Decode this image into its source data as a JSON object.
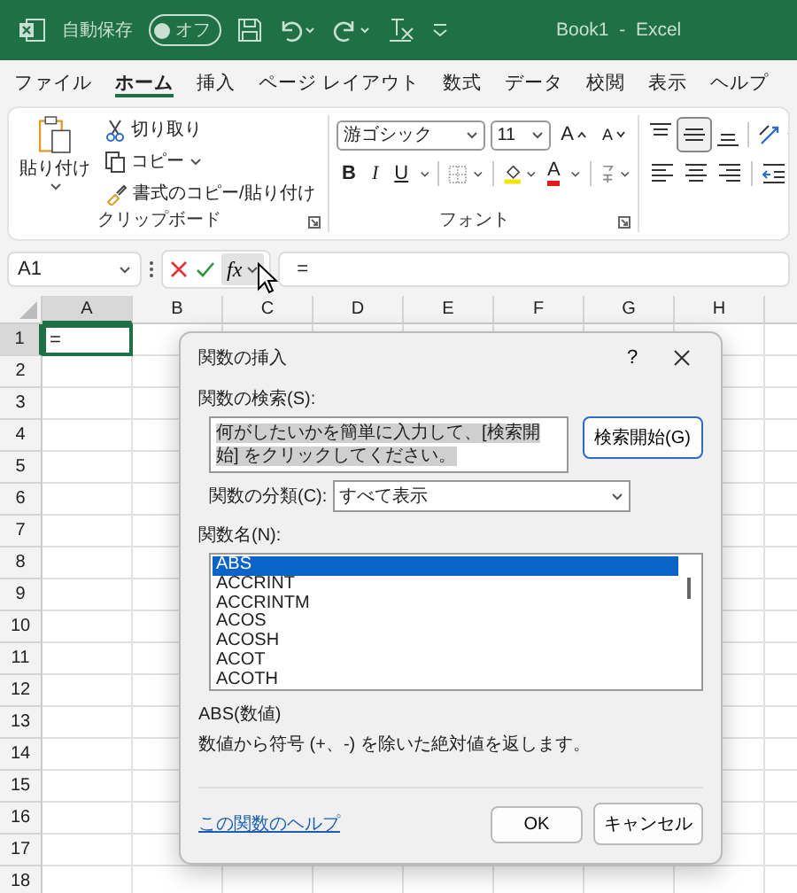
{
  "title_bar": {
    "autosave_label": "自動保存",
    "autosave": {
      "label": "オフ",
      "on": false
    },
    "document_title": "Book1  -  Excel"
  },
  "menu_tabs": [
    {
      "label": "ファイル",
      "selected": false
    },
    {
      "label": "ホーム",
      "selected": true
    },
    {
      "label": "挿入",
      "selected": false
    },
    {
      "label": "ページ レイアウト",
      "selected": false
    },
    {
      "label": "数式",
      "selected": false
    },
    {
      "label": "データ",
      "selected": false
    },
    {
      "label": "校閲",
      "selected": false
    },
    {
      "label": "表示",
      "selected": false
    },
    {
      "label": "ヘルプ",
      "selected": false
    }
  ],
  "ribbon": {
    "clipboard": {
      "paste": "貼り付け",
      "cut": "切り取り",
      "copy": "コピー",
      "format_painter": "書式のコピー/貼り付け",
      "group_label": "クリップボード"
    },
    "font": {
      "font_name": "游ゴシック",
      "font_size": "11",
      "grow": "A",
      "shrink": "A",
      "bold": "B",
      "italic": "I",
      "underline": "U",
      "font_color": "A",
      "group_label": "フォント"
    },
    "alignment": [
      {
        "kind": "top",
        "selected": false
      },
      {
        "kind": "middle",
        "selected": true
      },
      {
        "kind": "bottom",
        "selected": false
      },
      {
        "kind": "orientation",
        "selected": false
      },
      {
        "kind": "left",
        "selected": false
      },
      {
        "kind": "center",
        "selected": false
      },
      {
        "kind": "right",
        "selected": false
      },
      {
        "kind": "indent_decrease",
        "selected": false
      }
    ]
  },
  "formula_bar": {
    "name_box": "A1",
    "fx_label": "fx",
    "formula": "="
  },
  "sheet": {
    "columns": [
      {
        "label": "A",
        "selected": true
      },
      {
        "label": "B",
        "selected": false
      },
      {
        "label": "C",
        "selected": false
      },
      {
        "label": "D",
        "selected": false
      },
      {
        "label": "E",
        "selected": false
      },
      {
        "label": "F",
        "selected": false
      },
      {
        "label": "G",
        "selected": false
      },
      {
        "label": "H",
        "selected": false
      }
    ],
    "rows": [
      {
        "label": "1",
        "selected": true,
        "cells": [
          "="
        ]
      },
      {
        "label": "2",
        "selected": false
      },
      {
        "label": "3",
        "selected": false
      },
      {
        "label": "4",
        "selected": false
      },
      {
        "label": "5",
        "selected": false
      },
      {
        "label": "6",
        "selected": false
      },
      {
        "label": "7",
        "selected": false
      },
      {
        "label": "8",
        "selected": false
      },
      {
        "label": "9",
        "selected": false
      },
      {
        "label": "10",
        "selected": false
      },
      {
        "label": "11",
        "selected": false
      },
      {
        "label": "12",
        "selected": false
      },
      {
        "label": "13",
        "selected": false
      },
      {
        "label": "14",
        "selected": false
      },
      {
        "label": "15",
        "selected": false
      },
      {
        "label": "16",
        "selected": false
      },
      {
        "label": "17",
        "selected": false
      },
      {
        "label": "18",
        "selected": false
      }
    ]
  },
  "dialog": {
    "title": "関数の挿入",
    "help": "?",
    "search_label": "関数の検索(S):",
    "search_text": "何がしたいかを簡単に入力して、[検索開始] をクリックしてください。",
    "search_button": "検索開始(G)",
    "category_label": "関数の分類(C):",
    "category_value": "すべて表示",
    "functions_label": "関数名(N):",
    "functions": [
      {
        "name": "ABS",
        "selected": true
      },
      {
        "name": "ACCRINT",
        "selected": false
      },
      {
        "name": "ACCRINTM",
        "selected": false
      },
      {
        "name": "ACOS",
        "selected": false
      },
      {
        "name": "ACOSH",
        "selected": false
      },
      {
        "name": "ACOT",
        "selected": false
      },
      {
        "name": "ACOTH",
        "selected": false
      }
    ],
    "syntax": "ABS(数値)",
    "description": "数値から符号 (+、-) を除いた絶対値を返します。",
    "help_link": "この関数のヘルプ",
    "ok": "OK",
    "cancel": "キャンセル"
  }
}
